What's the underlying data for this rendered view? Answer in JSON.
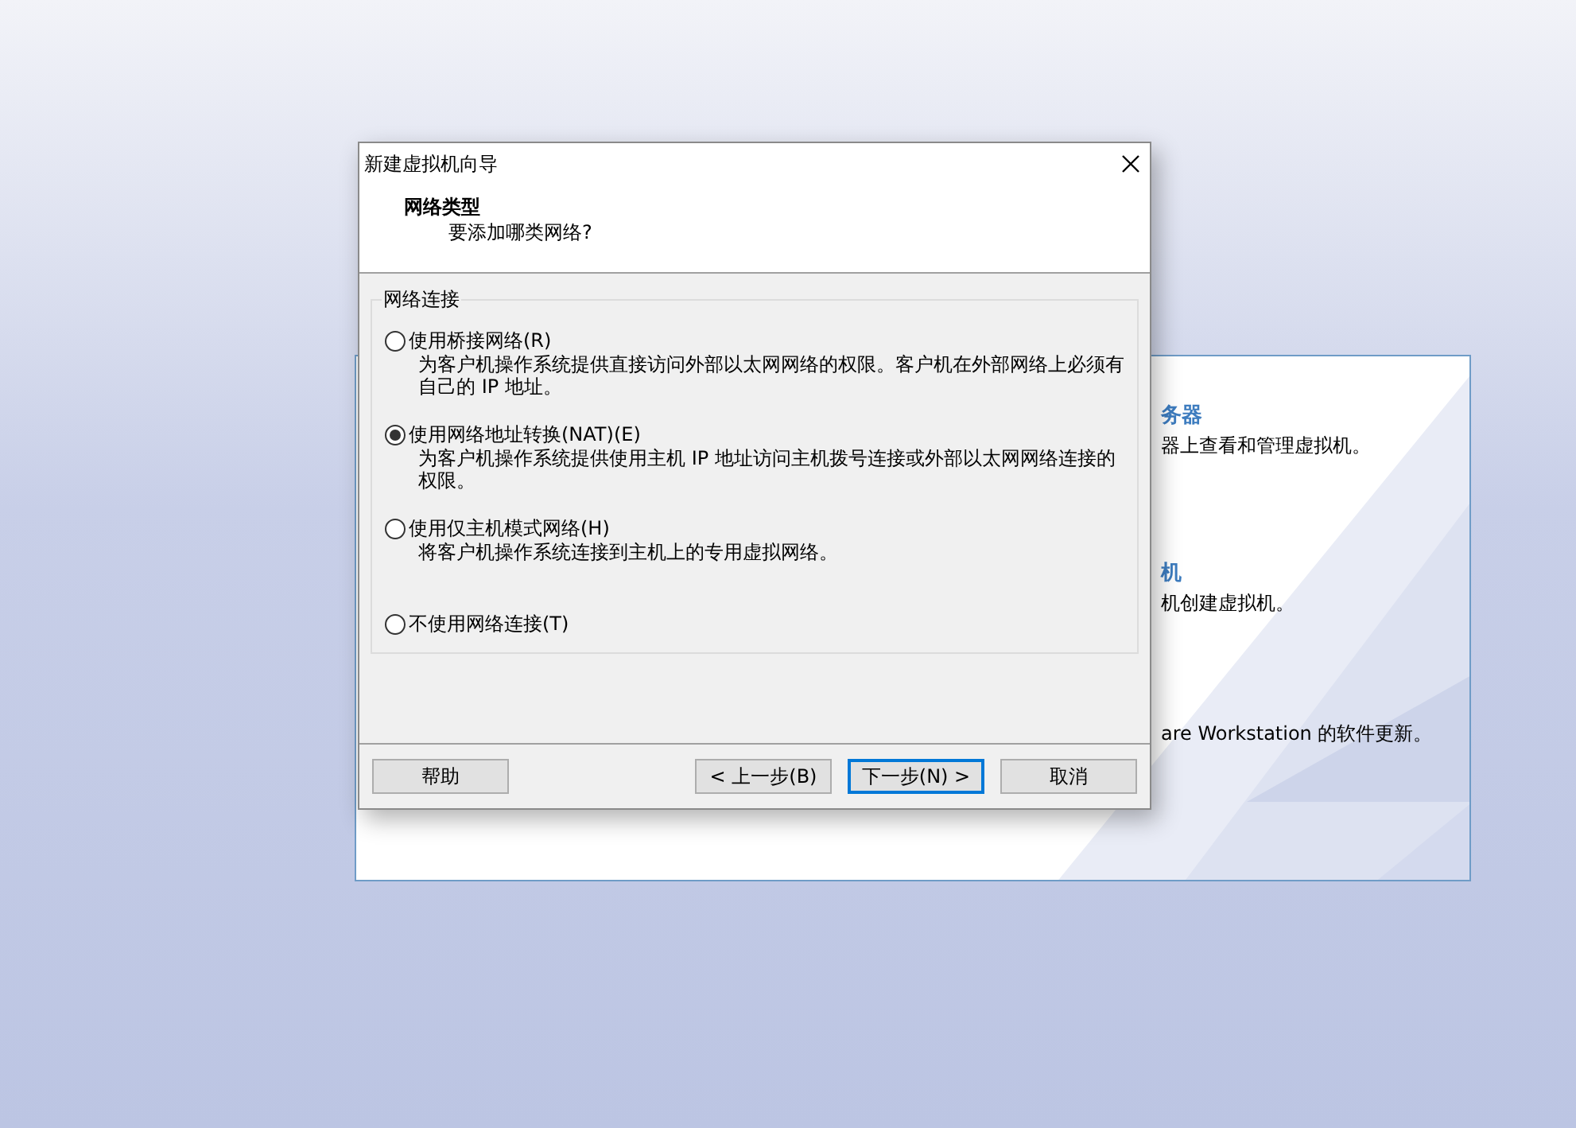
{
  "background_window": {
    "items": [
      {
        "title": "务器",
        "description": "器上查看和管理虚拟机。"
      },
      {
        "title": "机",
        "description": "机创建虚拟机。"
      },
      {
        "description": "are Workstation 的软件更新。"
      }
    ]
  },
  "window": {
    "title": "新建虚拟机向导"
  },
  "header": {
    "title": "网络类型",
    "subtitle": "要添加哪类网络?"
  },
  "group": {
    "label": "网络连接",
    "options": [
      {
        "label": "使用桥接网络(R)",
        "description": "为客户机操作系统提供直接访问外部以太网网络的权限。客户机在外部网络上必须有自己的 IP 地址。",
        "selected": false
      },
      {
        "label": "使用网络地址转换(NAT)(E)",
        "description": "为客户机操作系统提供使用主机 IP 地址访问主机拨号连接或外部以太网网络连接的权限。",
        "selected": true
      },
      {
        "label": "使用仅主机模式网络(H)",
        "description": "将客户机操作系统连接到主机上的专用虚拟网络。",
        "selected": false
      },
      {
        "label": "不使用网络连接(T)",
        "selected": false
      }
    ]
  },
  "buttons": [
    {
      "label": "帮助",
      "focused": false
    },
    {
      "label": "< 上一步(B)",
      "focused": false
    },
    {
      "label": "下一步(N) >",
      "focused": true
    },
    {
      "label": "取消",
      "focused": false
    }
  ]
}
